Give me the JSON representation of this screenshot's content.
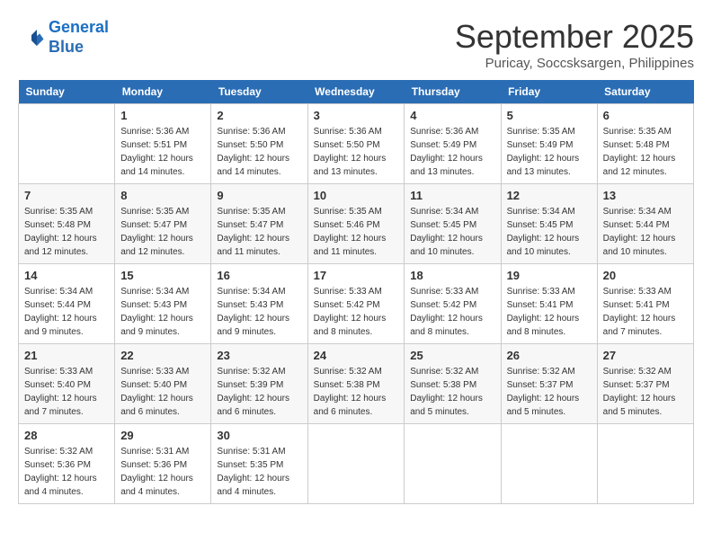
{
  "header": {
    "logo_line1": "General",
    "logo_line2": "Blue",
    "month": "September 2025",
    "location": "Puricay, Soccsksargen, Philippines"
  },
  "days_of_week": [
    "Sunday",
    "Monday",
    "Tuesday",
    "Wednesday",
    "Thursday",
    "Friday",
    "Saturday"
  ],
  "weeks": [
    [
      {
        "day": "",
        "info": ""
      },
      {
        "day": "1",
        "info": "Sunrise: 5:36 AM\nSunset: 5:51 PM\nDaylight: 12 hours\nand 14 minutes."
      },
      {
        "day": "2",
        "info": "Sunrise: 5:36 AM\nSunset: 5:50 PM\nDaylight: 12 hours\nand 14 minutes."
      },
      {
        "day": "3",
        "info": "Sunrise: 5:36 AM\nSunset: 5:50 PM\nDaylight: 12 hours\nand 13 minutes."
      },
      {
        "day": "4",
        "info": "Sunrise: 5:36 AM\nSunset: 5:49 PM\nDaylight: 12 hours\nand 13 minutes."
      },
      {
        "day": "5",
        "info": "Sunrise: 5:35 AM\nSunset: 5:49 PM\nDaylight: 12 hours\nand 13 minutes."
      },
      {
        "day": "6",
        "info": "Sunrise: 5:35 AM\nSunset: 5:48 PM\nDaylight: 12 hours\nand 12 minutes."
      }
    ],
    [
      {
        "day": "7",
        "info": "Sunrise: 5:35 AM\nSunset: 5:48 PM\nDaylight: 12 hours\nand 12 minutes."
      },
      {
        "day": "8",
        "info": "Sunrise: 5:35 AM\nSunset: 5:47 PM\nDaylight: 12 hours\nand 12 minutes."
      },
      {
        "day": "9",
        "info": "Sunrise: 5:35 AM\nSunset: 5:47 PM\nDaylight: 12 hours\nand 11 minutes."
      },
      {
        "day": "10",
        "info": "Sunrise: 5:35 AM\nSunset: 5:46 PM\nDaylight: 12 hours\nand 11 minutes."
      },
      {
        "day": "11",
        "info": "Sunrise: 5:34 AM\nSunset: 5:45 PM\nDaylight: 12 hours\nand 10 minutes."
      },
      {
        "day": "12",
        "info": "Sunrise: 5:34 AM\nSunset: 5:45 PM\nDaylight: 12 hours\nand 10 minutes."
      },
      {
        "day": "13",
        "info": "Sunrise: 5:34 AM\nSunset: 5:44 PM\nDaylight: 12 hours\nand 10 minutes."
      }
    ],
    [
      {
        "day": "14",
        "info": "Sunrise: 5:34 AM\nSunset: 5:44 PM\nDaylight: 12 hours\nand 9 minutes."
      },
      {
        "day": "15",
        "info": "Sunrise: 5:34 AM\nSunset: 5:43 PM\nDaylight: 12 hours\nand 9 minutes."
      },
      {
        "day": "16",
        "info": "Sunrise: 5:34 AM\nSunset: 5:43 PM\nDaylight: 12 hours\nand 9 minutes."
      },
      {
        "day": "17",
        "info": "Sunrise: 5:33 AM\nSunset: 5:42 PM\nDaylight: 12 hours\nand 8 minutes."
      },
      {
        "day": "18",
        "info": "Sunrise: 5:33 AM\nSunset: 5:42 PM\nDaylight: 12 hours\nand 8 minutes."
      },
      {
        "day": "19",
        "info": "Sunrise: 5:33 AM\nSunset: 5:41 PM\nDaylight: 12 hours\nand 8 minutes."
      },
      {
        "day": "20",
        "info": "Sunrise: 5:33 AM\nSunset: 5:41 PM\nDaylight: 12 hours\nand 7 minutes."
      }
    ],
    [
      {
        "day": "21",
        "info": "Sunrise: 5:33 AM\nSunset: 5:40 PM\nDaylight: 12 hours\nand 7 minutes."
      },
      {
        "day": "22",
        "info": "Sunrise: 5:33 AM\nSunset: 5:40 PM\nDaylight: 12 hours\nand 6 minutes."
      },
      {
        "day": "23",
        "info": "Sunrise: 5:32 AM\nSunset: 5:39 PM\nDaylight: 12 hours\nand 6 minutes."
      },
      {
        "day": "24",
        "info": "Sunrise: 5:32 AM\nSunset: 5:38 PM\nDaylight: 12 hours\nand 6 minutes."
      },
      {
        "day": "25",
        "info": "Sunrise: 5:32 AM\nSunset: 5:38 PM\nDaylight: 12 hours\nand 5 minutes."
      },
      {
        "day": "26",
        "info": "Sunrise: 5:32 AM\nSunset: 5:37 PM\nDaylight: 12 hours\nand 5 minutes."
      },
      {
        "day": "27",
        "info": "Sunrise: 5:32 AM\nSunset: 5:37 PM\nDaylight: 12 hours\nand 5 minutes."
      }
    ],
    [
      {
        "day": "28",
        "info": "Sunrise: 5:32 AM\nSunset: 5:36 PM\nDaylight: 12 hours\nand 4 minutes."
      },
      {
        "day": "29",
        "info": "Sunrise: 5:31 AM\nSunset: 5:36 PM\nDaylight: 12 hours\nand 4 minutes."
      },
      {
        "day": "30",
        "info": "Sunrise: 5:31 AM\nSunset: 5:35 PM\nDaylight: 12 hours\nand 4 minutes."
      },
      {
        "day": "",
        "info": ""
      },
      {
        "day": "",
        "info": ""
      },
      {
        "day": "",
        "info": ""
      },
      {
        "day": "",
        "info": ""
      }
    ]
  ]
}
